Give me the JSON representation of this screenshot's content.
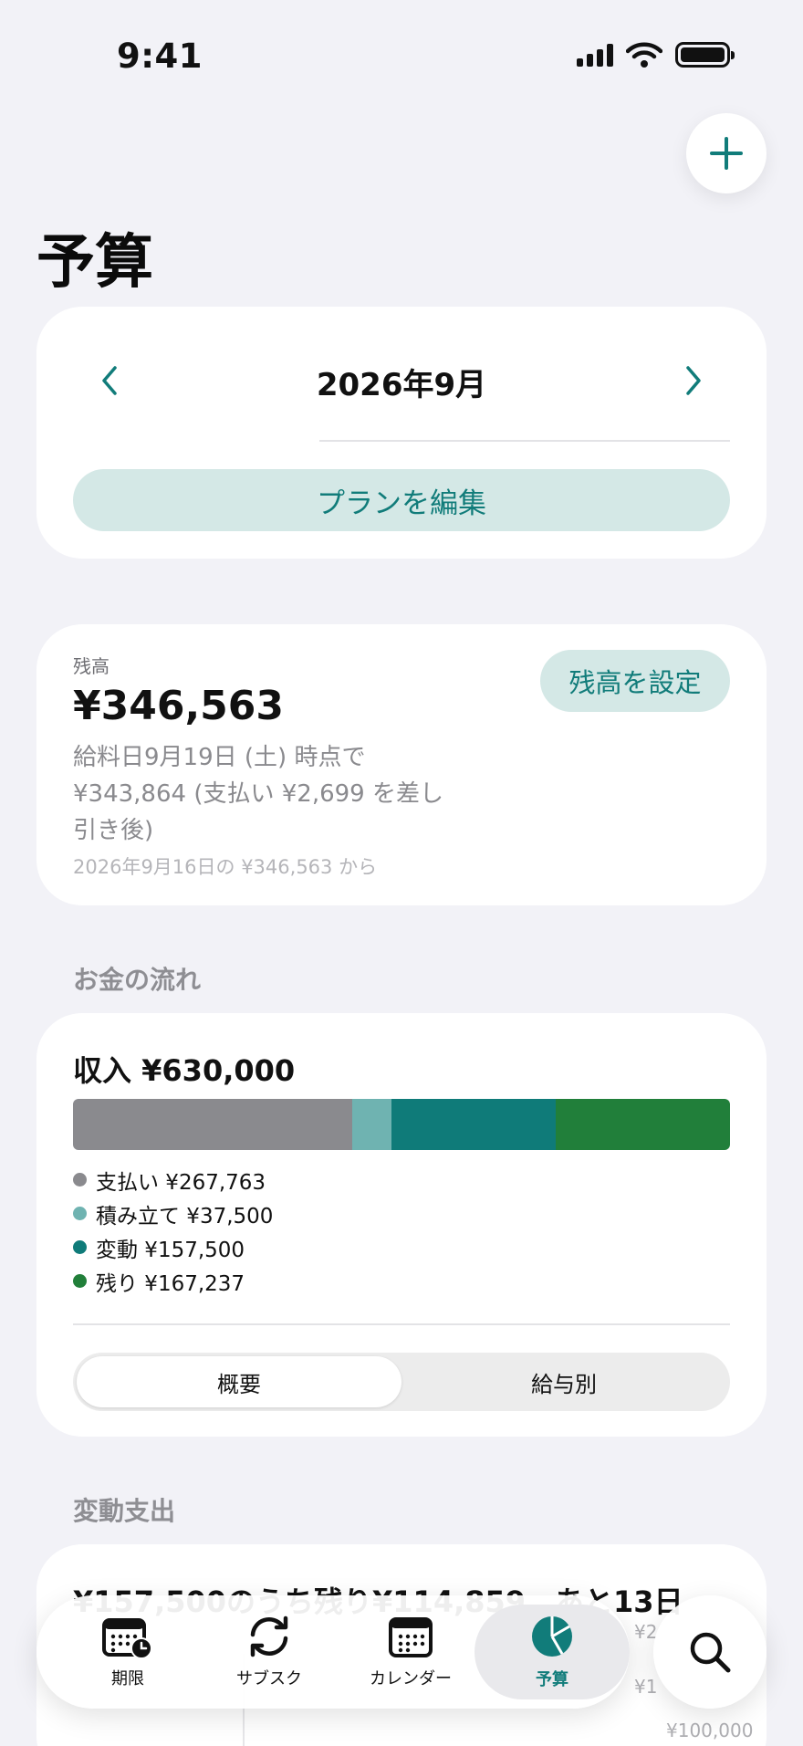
{
  "status_bar": {
    "time": "9:41"
  },
  "header": {
    "title": "予算"
  },
  "month_nav": {
    "label": "2026年9月",
    "edit_plan": "プランを編集"
  },
  "balance": {
    "label": "残高",
    "amount": "¥346,563",
    "description": "給料日9月19日 (土) 時点で ¥343,864 (支払い ¥2,699 を差し引き後)",
    "from_text": "2026年9月16日の ¥346,563 から",
    "set_button": "残高を設定"
  },
  "flow": {
    "section_title": "お金の流れ",
    "income": "収入 ¥630,000",
    "segments": [
      {
        "label": "支払い ¥267,763",
        "value": 267763,
        "color": "#8a8a8e"
      },
      {
        "label": "積み立て ¥37,500",
        "value": 37500,
        "color": "#6fb3b1"
      },
      {
        "label": "変動 ¥157,500",
        "value": 157500,
        "color": "#0f7b79"
      },
      {
        "label": "残り ¥167,237",
        "value": 167237,
        "color": "#217f3a"
      }
    ],
    "tabs": [
      "概要",
      "給与別"
    ]
  },
  "variable": {
    "section_title": "変動支出",
    "summary": "¥157,500のうち残り¥114,859、あと13日",
    "axis_labels": [
      "¥2",
      "¥1",
      "¥100,000"
    ]
  },
  "tab_bar": {
    "items": [
      {
        "label": "期限",
        "icon": "calendar-clock-icon"
      },
      {
        "label": "サブスク",
        "icon": "refresh-icon"
      },
      {
        "label": "カレンダー",
        "icon": "calendar-icon"
      },
      {
        "label": "予算",
        "icon": "pie-chart-icon"
      }
    ],
    "active_index": 3
  },
  "colors": {
    "accent": "#117c7a",
    "accent_bg": "#d4e8e6"
  }
}
